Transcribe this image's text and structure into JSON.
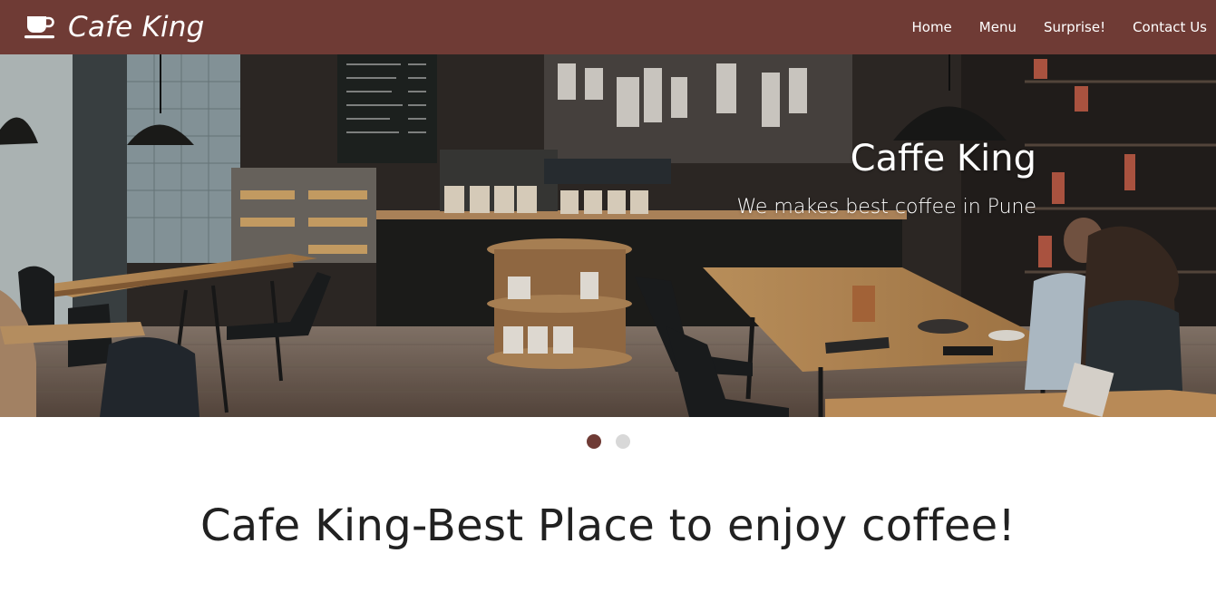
{
  "navbar": {
    "brand": "Cafe King",
    "brand_icon": "coffee-cup-icon",
    "links": [
      "Home",
      "Menu",
      "Surprise!",
      "Contact Us"
    ],
    "background": "#6f3b35"
  },
  "carousel": {
    "slide_title": "Caffe King",
    "slide_subtitle": "We makes best coffee in Pune",
    "indicators_count": 2,
    "active_indicator": 1,
    "active_color": "#6f3b35",
    "inactive_color": "#d8d8d8"
  },
  "main": {
    "headline": "Cafe King-Best Place to enjoy coffee!"
  }
}
